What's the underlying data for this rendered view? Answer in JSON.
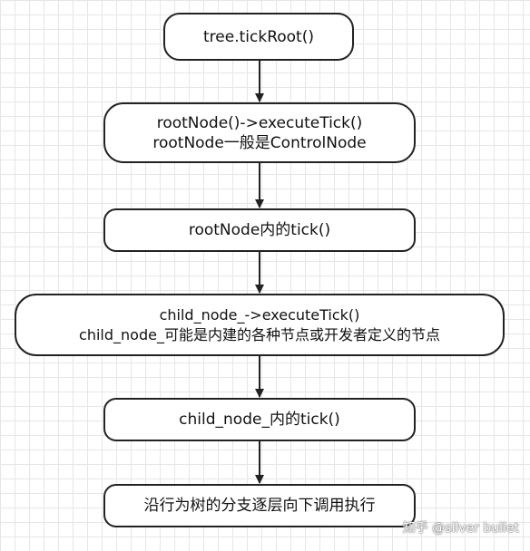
{
  "nodes": {
    "n1": {
      "lines": [
        "tree.tickRoot()"
      ]
    },
    "n2": {
      "lines": [
        "rootNode()->executeTick()",
        "rootNode一般是ControlNode"
      ]
    },
    "n3": {
      "lines": [
        "rootNode内的tick()"
      ]
    },
    "n4": {
      "lines": [
        "child_node_->executeTick()",
        "child_node_可能是内建的各种节点或开发者定义的节点"
      ]
    },
    "n5": {
      "lines": [
        "child_node_内的tick()"
      ]
    },
    "n6": {
      "lines": [
        "沿行为树的分支逐层向下调用执行"
      ]
    }
  },
  "watermark": "知乎 @silver bullet",
  "colors": {
    "stroke": "#222222",
    "grid": "#e6e6e6",
    "background": "#ffffff"
  }
}
